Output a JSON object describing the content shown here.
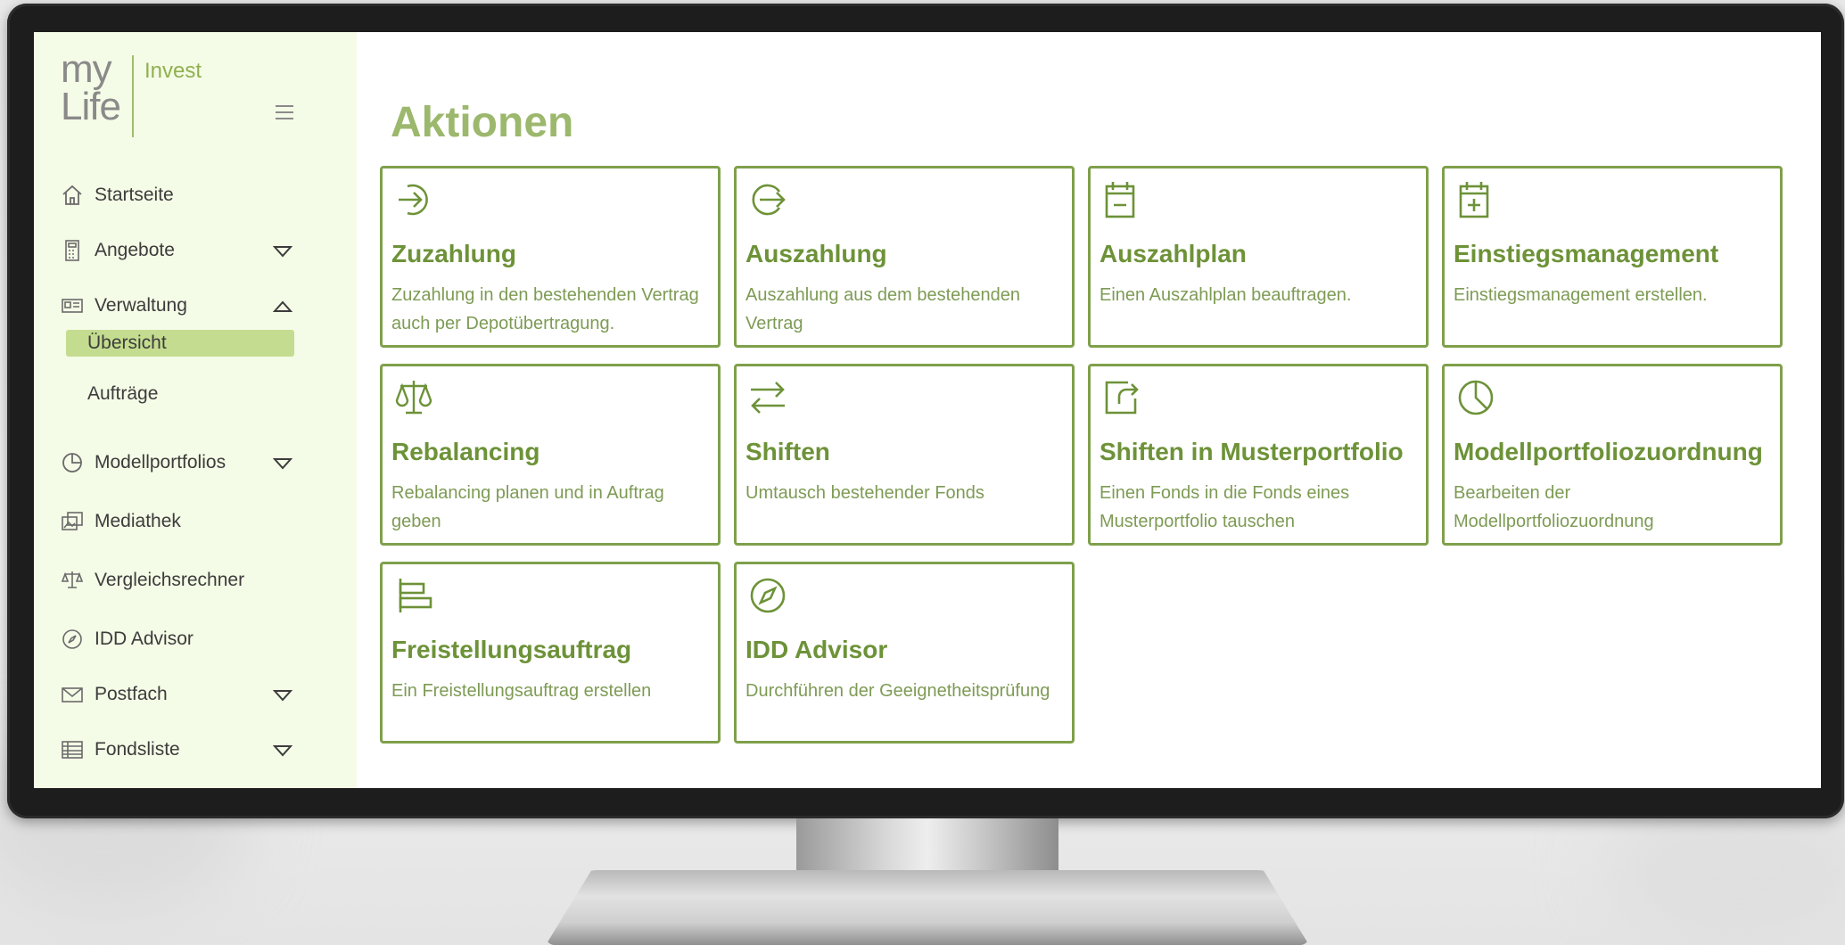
{
  "brand": {
    "logo_my": "my",
    "logo_life": "Life",
    "logo_invest": "Invest"
  },
  "sidebar": {
    "items": [
      {
        "label": "Startseite",
        "icon": "home-icon"
      },
      {
        "label": "Angebote",
        "icon": "calculator-icon",
        "caret": "down"
      },
      {
        "label": "Verwaltung",
        "icon": "id-card-icon",
        "caret": "up"
      },
      {
        "label": "Übersicht",
        "sub": true,
        "active": true
      },
      {
        "label": "Aufträge",
        "sub": true
      },
      {
        "label": "Modellportfolios",
        "icon": "pie-chart-icon",
        "caret": "down"
      },
      {
        "label": "Mediathek",
        "icon": "media-icon"
      },
      {
        "label": "Vergleichsrechner",
        "icon": "scale-icon"
      },
      {
        "label": "IDD Advisor",
        "icon": "compass-icon"
      },
      {
        "label": "Postfach",
        "icon": "mail-icon",
        "caret": "down"
      },
      {
        "label": "Fondsliste",
        "icon": "table-icon",
        "caret": "down"
      }
    ]
  },
  "main": {
    "title": "Aktionen",
    "cards": [
      {
        "title": "Zuzahlung",
        "desc": "Zuzahlung in den bestehenden Vertrag auch per Depotübertragung.",
        "icon": "arrow-in-circle-icon"
      },
      {
        "title": "Auszahlung",
        "desc": "Auszahlung aus dem bestehenden Vertrag",
        "icon": "arrow-out-circle-icon"
      },
      {
        "title": "Auszahlplan",
        "desc": "Einen Auszahlplan beauftragen.",
        "icon": "calendar-minus-icon"
      },
      {
        "title": "Einstiegsmanagement",
        "desc": "Einstiegsmanagement erstellen.",
        "icon": "calendar-plus-icon"
      },
      {
        "title": "Rebalancing",
        "desc": "Rebalancing planen und in Auftrag geben",
        "icon": "scale-icon"
      },
      {
        "title": "Shiften",
        "desc": "Umtausch bestehender Fonds",
        "icon": "swap-arrows-icon"
      },
      {
        "title": "Shiften in Musterportfolio",
        "desc": "Einen Fonds in die Fonds eines Musterportfolio tauschen",
        "icon": "share-box-icon"
      },
      {
        "title": "Modellportfoliozuordnung",
        "desc": "Bearbeiten der Modellportfoliozuordnung",
        "icon": "pie-chart-icon"
      },
      {
        "title": "Freistellungsauftrag",
        "desc": "Ein Freistellungsauftrag erstellen",
        "icon": "align-bars-icon"
      },
      {
        "title": "IDD Advisor",
        "desc": "Durchführen der Geeignetheitsprüfung",
        "icon": "compass-icon"
      }
    ]
  },
  "colors": {
    "accent": "#7fa04b",
    "title": "#9cb86d",
    "sidebar_bg": "#f4fbe6",
    "active_bg": "#c4dc8f"
  }
}
